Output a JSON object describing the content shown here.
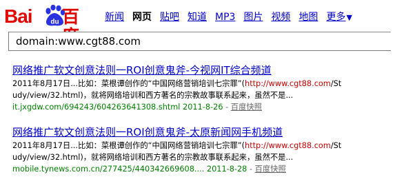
{
  "logo": {
    "text_latin": "Bai",
    "text_paw": "du",
    "text_cn": "百度",
    "color": "#e10602",
    "paw_color": "#2932e1"
  },
  "nav": {
    "items": [
      {
        "label": "新闻",
        "current": false
      },
      {
        "label": "网页",
        "current": true
      },
      {
        "label": "贴吧",
        "current": false
      },
      {
        "label": "知道",
        "current": false
      },
      {
        "label": "MP3",
        "current": false
      },
      {
        "label": "图片",
        "current": false
      },
      {
        "label": "视频",
        "current": false
      },
      {
        "label": "地图",
        "current": false
      }
    ],
    "more_label": "更多",
    "more_arrow": "▼",
    "link_color": "#0000cc"
  },
  "search": {
    "value": "domain:www.cgt88.com"
  },
  "results": [
    {
      "title": "网络推广软文创意法则一ROI创意鬼斧-今视网IT综合频道",
      "abstract_line1_pre": "2011年8月17日...比如：菜根谭创作的“中国网络营销培训七宗罪”(",
      "abstract_line1_hl": "http://www.cgt88.com",
      "abstract_line1_post": "/St",
      "abstract_line2": "udy/view/32.html)，就将网络培训和西方著名的宗教故事联系起来，虽然不是...",
      "url": "it.jxgdw.com/694243/604263641308.shtml",
      "date": "2011-8-26",
      "sep": " - ",
      "cache_label": "百度快照"
    },
    {
      "title": "网络推广软文创意法则一ROI创意鬼斧-太原新闻网手机频道",
      "abstract_line1_pre": "2011年8月17日...比如：菜根谭创作的“中国网络营销培训七宗罪”(",
      "abstract_line1_hl": "http://www.cgt88.com",
      "abstract_line1_post": "/St",
      "abstract_line2": "udy/view/32.html)，就将网络培训和西方著名的宗教故事联系起来，虽然不是...",
      "url": "mobile.tynews.com.cn/277425/440342669608.",
      "url_ellipsis": "...",
      "date": "2011-8-28",
      "sep": " - ",
      "cache_label": "百度快照"
    }
  ]
}
